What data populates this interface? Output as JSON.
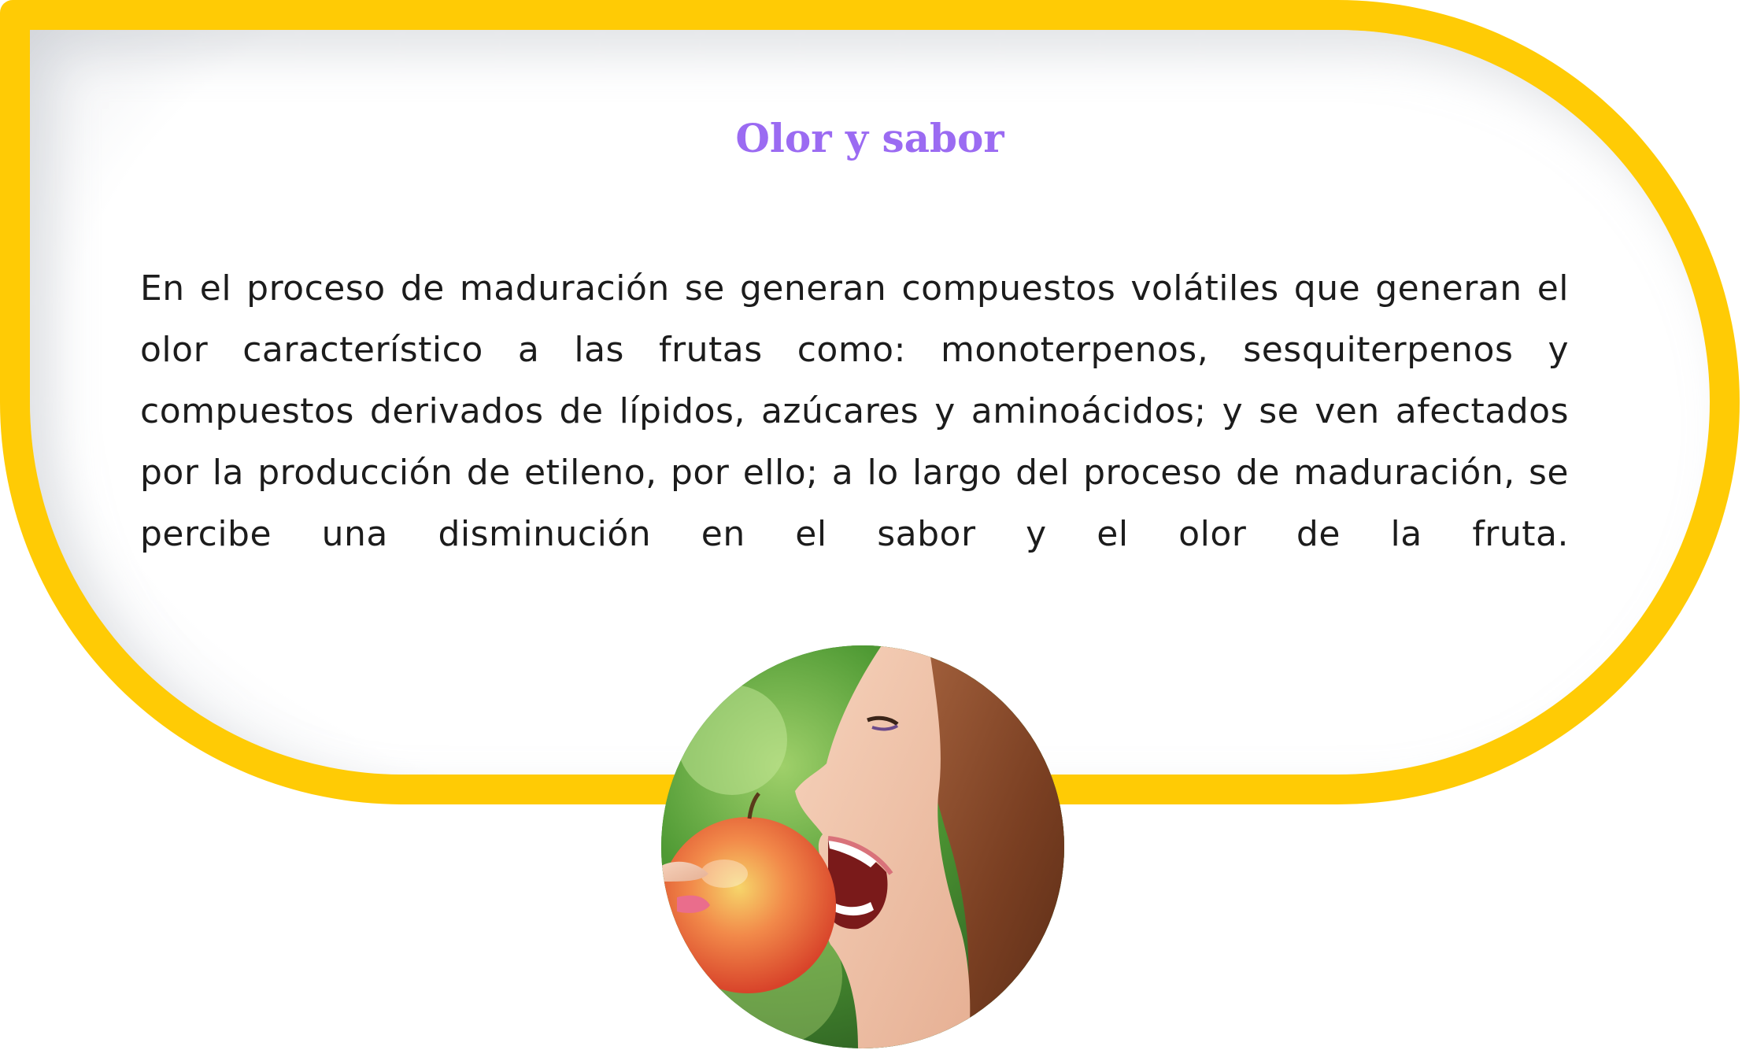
{
  "card": {
    "title": "Olor y sabor",
    "paragraph": "En el proceso de maduración se generan compuestos volátiles que generan el olor característico a las frutas como: monoterpenos, sesquiterpenos y compuestos derivados de lípidos, azúcares y aminoácidos; y se ven afectados por la producción de etileno, por ello; a lo largo del proceso de maduración, se percibe una disminución en el sabor y el olor de la fruta."
  },
  "colors": {
    "frame": "#FFCB05",
    "title": "#9B6BF2",
    "text": "#1c1c1c"
  },
  "image": {
    "subject": "woman-biting-apple-photo"
  }
}
